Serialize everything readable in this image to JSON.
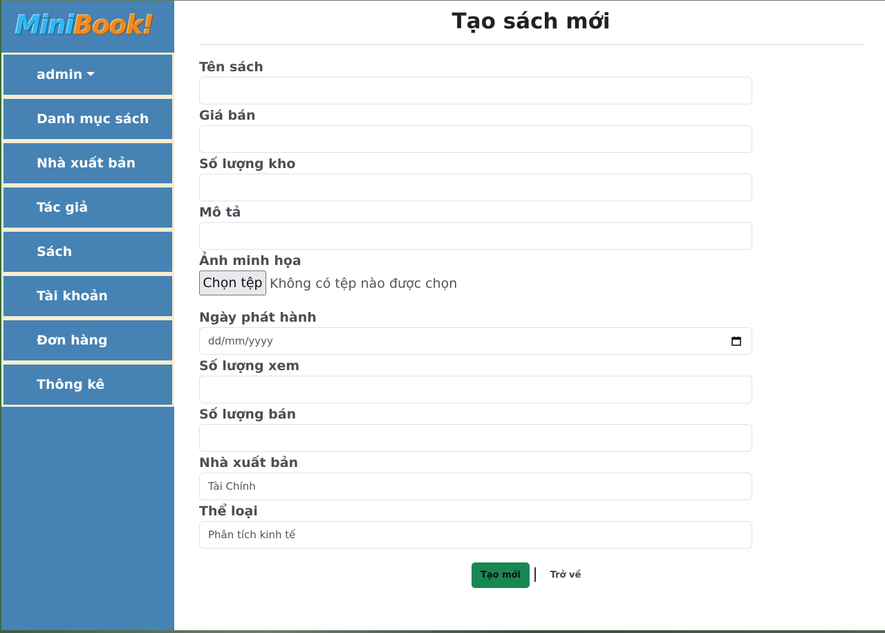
{
  "logo": {
    "part1": "Mini",
    "part2": "Book!"
  },
  "sidebar": {
    "user": "admin",
    "items": [
      {
        "label": "Danh mục sách"
      },
      {
        "label": "Nhà xuất bản"
      },
      {
        "label": "Tác giả"
      },
      {
        "label": "Sách"
      },
      {
        "label": "Tài khoản"
      },
      {
        "label": "Đơn hàng"
      },
      {
        "label": "Thông kê"
      }
    ]
  },
  "page": {
    "title": "Tạo sách mới"
  },
  "form": {
    "name_label": "Tên sách",
    "price_label": "Giá bán",
    "stock_label": "Số lượng kho",
    "description_label": "Mô tả",
    "image_label": "Ảnh minh họa",
    "file_button": "Chọn tệp",
    "file_status": "Không có tệp nào được chọn",
    "release_date_label": "Ngày phát hành",
    "release_date_placeholder": "dd/mm/yyyy",
    "views_label": "Số lượng xem",
    "sold_label": "Số lượng bán",
    "publisher_label": "Nhà xuất bản",
    "publisher_value": "Tài Chính",
    "category_label": "Thể loại",
    "category_value": "Phân tích kinh tế"
  },
  "actions": {
    "create": "Tạo mới",
    "back": "Trở về"
  },
  "colors": {
    "sidebar": "#4682b4",
    "menu_border": "#f8ecd0",
    "create_button": "#198754"
  }
}
